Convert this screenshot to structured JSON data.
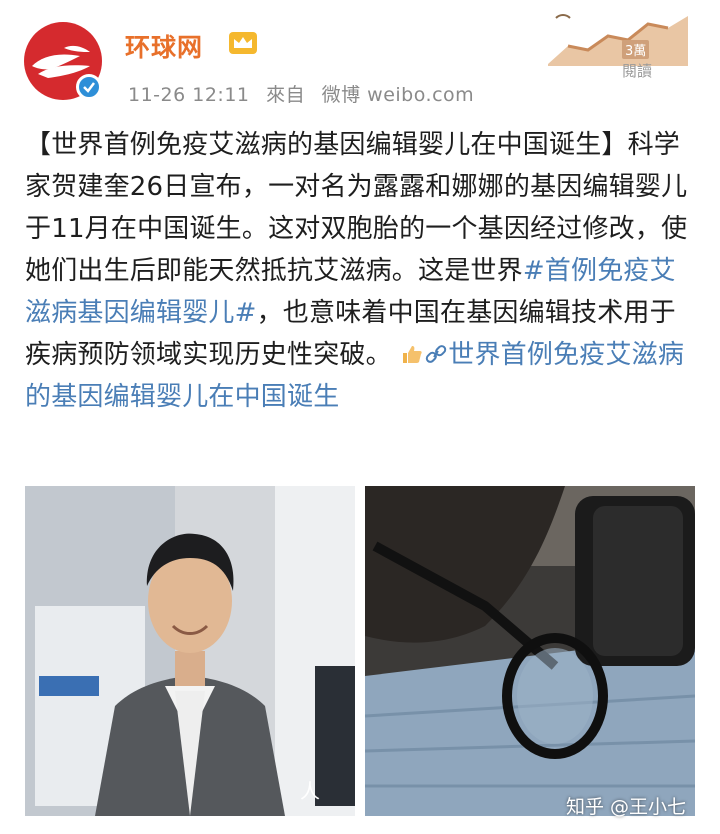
{
  "account": {
    "name": "环球网",
    "timestamp": "11-26 12:11",
    "source_prefix": "來自",
    "source": "微博 weibo.com",
    "verified_icon": "verified-badge-icon",
    "crown_icon": "crown-icon"
  },
  "views": {
    "count": "3萬",
    "label": "閱讀"
  },
  "post": {
    "text_intro": "【世界首例免疫艾滋病的基因编辑婴儿在中国诞生】科学家贺建奎26日宣布，一对名为露露和娜娜的基因编辑婴儿于11月在中国诞生。这对双胞胎的一个基因经过修改，使她们出生后即能天然抵抗艾滋病。这是世界",
    "hashtag": "#首例免疫艾滋病基因编辑婴儿#",
    "text_after_hashtag": "，也意味着中国在基因编辑技术用于疾病预防领域实现历史性突破。",
    "link_text": "世界首例免疫艾滋病的基因编辑婴儿在中国诞生",
    "colors": {
      "link": "#4a7eb6",
      "name": "#e8702a"
    }
  },
  "photos": {
    "left_credit": "人",
    "left_icon": "person-portrait",
    "right_icon": "microscope-eyepiece"
  },
  "watermark": "知乎 @王小七"
}
